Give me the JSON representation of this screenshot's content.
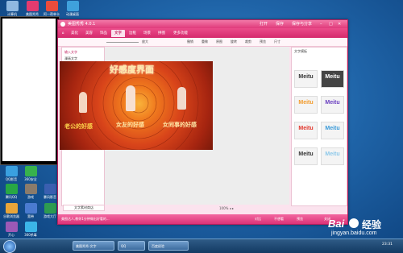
{
  "desktop": {
    "icons_top": [
      {
        "label": "计算机",
        "color": "#8fb8e0"
      },
      {
        "label": "美图秀秀",
        "color": "#e23b6f"
      },
      {
        "label": "阿一帮单卡",
        "color": "#e94c3c"
      },
      {
        "label": "动漫桌面",
        "color": "#3fa1dc"
      }
    ],
    "icons_left": [
      {
        "label": "QQ影音",
        "color": "#3aa0e0"
      },
      {
        "label": "360安全",
        "color": "#37b24d"
      },
      {
        "label": "腾讯QQ",
        "color": "#28a745"
      },
      {
        "label": "游戏",
        "color": "#8a7b6b"
      },
      {
        "label": "暴风影音",
        "color": "#3a5fb0"
      },
      {
        "label": "谷歌浏览器",
        "color": "#e8a53a"
      },
      {
        "label": "宽带",
        "color": "#4a7bd0"
      },
      {
        "label": "游戏大厅",
        "color": "#2d9b50"
      },
      {
        "label": "开心",
        "color": "#9b59b6"
      },
      {
        "label": "360杀毒",
        "color": "#3bb5e8"
      },
      {
        "label": "软件管家",
        "color": "#d64545"
      },
      {
        "label": "迅雷",
        "color": "#2f80ed"
      }
    ]
  },
  "app": {
    "title": "美图秀秀 4.0.1",
    "title_buttons": [
      "打开",
      "保存",
      "保存与分享"
    ],
    "menu_tabs": [
      "美化",
      "美容",
      "饰品",
      "文字",
      "边框",
      "场景",
      "拼图",
      "更多功能"
    ],
    "active_tab": "文字",
    "toolbar": {
      "zoom_label": "放大",
      "buttons": [
        "撤销",
        "重做",
        "原图",
        "旋转",
        "裁剪",
        "预览",
        "尺寸"
      ]
    },
    "left_panel": {
      "items": [
        "输入文字",
        "漫画文字",
        "动画闪字",
        "文字模板"
      ],
      "sub_items": [
        "热门",
        "网络流行语",
        "搞笑",
        "节日",
        "祝福",
        "其他"
      ],
      "import_button": "导入模板",
      "store_button": "文字素材商店"
    },
    "photo": {
      "title": "好感度界面",
      "labels": [
        "老公的好感",
        "女友的好感",
        "女同事的好感"
      ]
    },
    "right_panel": {
      "header": "文字模板",
      "font_tiles": [
        {
          "text": "Meitu",
          "color": "#333333"
        },
        {
          "text": "Meitu",
          "color": "#ffffff"
        },
        {
          "text": "Meitu",
          "color": "#f29b2c"
        },
        {
          "text": "Meitu",
          "color": "#6a3fc0"
        },
        {
          "text": "Meitu",
          "color": "#e2342a"
        },
        {
          "text": "Meitu",
          "color": "#3a9ad9"
        },
        {
          "text": "Meitu",
          "color": "#333333"
        },
        {
          "text": "Meitu",
          "color": "#8ec9ea"
        }
      ]
    },
    "canvas_status": "100%  ◂ ▸",
    "statusbar": {
      "left_text": "美图达人,教你1分钟做出好看的...",
      "right_buttons": [
        "对比",
        "不想看",
        "预览",
        "关闭"
      ]
    }
  },
  "taskbar": {
    "items": [
      "美图秀秀-文字",
      "QQ",
      "百度经验"
    ],
    "time": "23:31"
  },
  "watermark": {
    "brand": "Bai",
    "brand2": "经验",
    "url": "jingyan.baidu.com"
  },
  "colors": {
    "accent": "#e03a7c",
    "taskbar": "#1f4a78"
  }
}
